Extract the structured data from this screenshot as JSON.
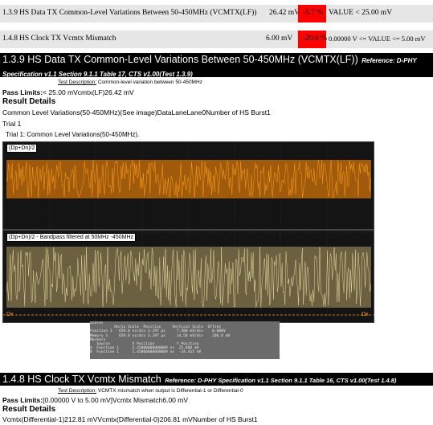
{
  "summary": [
    {
      "num": "1.3.9",
      "name": "HS Data TX Common-Level Variations Between 50-450MHz (VCMTX(LF))",
      "value": "26.42 mV",
      "pct": "-5.7 %",
      "limit": "VALUE < 25.00 mV"
    },
    {
      "num": "1.4.8",
      "name": "HS Clock TX Vcmtx Mismatch",
      "value": "6.00 mV",
      "pct": "-20.0 %",
      "limit": "0.00000 V <= VALUE <= 5.00 mV"
    }
  ],
  "sec1": {
    "title": "1.3.9 HS Data TX Common-Level Variations Between 50-450MHz (VCMTX(LF))",
    "ref": "Reference: D-PHY Specification v1.1 Section 9.1.1 Table 17, CTS v1.00(Test 1.3.9)",
    "desc_label": "Test Description:",
    "desc": "Common-level variation between 50-450MHz",
    "pass_label": "Pass Limits:",
    "pass_value": "< 25.00 mVcmtx(LF)26.42 mV",
    "result_details": "Result Details",
    "result_line": "Common Level Variations(50-450MHz)(See image)DataLaneLane0Number of HS Burst1",
    "trial": "Trial 1",
    "trial_caption": "Trial 1: Common Level Variations(50-450MHz).",
    "scope_label_top": "(Dp+Dn)/2",
    "scope_label_bottom": "(Dp+Dn)/2 - Bandpass filtered at 50MHz -450MHz",
    "marker_left": "Dx",
    "marker_right": "Dx",
    "info_text": "Scales\n           Horiz Scale  Position     Vertical Scale  Offset\nFunction 1   659.0 ns/div 3.297 µs     7.500 mV/div    0.000V\nMemory 1     659.0 ns/div 3.297 µs     14.50 mV/div    206.0 mV\nMarkers\n   Source          X Position          Y Position\nA  Function 1      2.45000000000009 ns  25.888 mV\nB  Function 1      2.45000000000009 ns  -24.415 mV"
  },
  "sec2": {
    "title": "1.4.8 HS Clock TX Vcmtx Mismatch",
    "ref": "Reference: D-PHY Specification v1.1 Section 9.1.1 Table 16, CTS v1.00(Test 1.4.8)",
    "desc_label": "Test Description:",
    "desc": "VCMTX mismatch when output is Differential-1 or Differential-0",
    "pass_label": "Pass Limits:",
    "pass_value": "[0.00000 V to 5.00 mV]Vcmtx Mismatch6.00 mV",
    "result_details": "Result Details",
    "result_line": "Vcmtx(Differential-1)212.81 mVVcmtx(Differential-0)206.81 mVNumber of HS Burst1"
  },
  "colors": {
    "accent_red": "#ff0000",
    "trace_top": "#ff9e1a",
    "trace_bottom": "#e8d9a0",
    "scope_bg": "#141414"
  }
}
